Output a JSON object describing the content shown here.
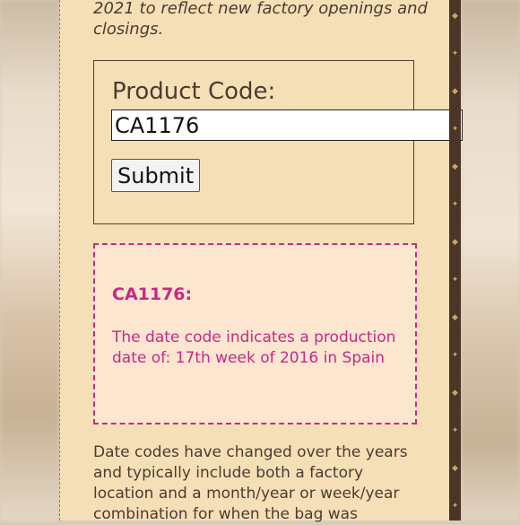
{
  "intro_text": "2021 to reflect new factory openings and closings.",
  "form": {
    "label": "Product Code:",
    "input_value": "CA1176",
    "submit_label": "Submit"
  },
  "result": {
    "code_heading": "CA1176:",
    "message": "The date code indicates a production date of: 17th week of 2016 in Spain"
  },
  "outro_text": "Date codes have changed over the years and typically include both a factory location and a month/year or week/year combination for when the bag was",
  "colors": {
    "panel_background": "#f5dfb6",
    "accent_magenta": "#c42a86",
    "result_background": "#fde6d0",
    "text_brown": "#4a3c32"
  }
}
